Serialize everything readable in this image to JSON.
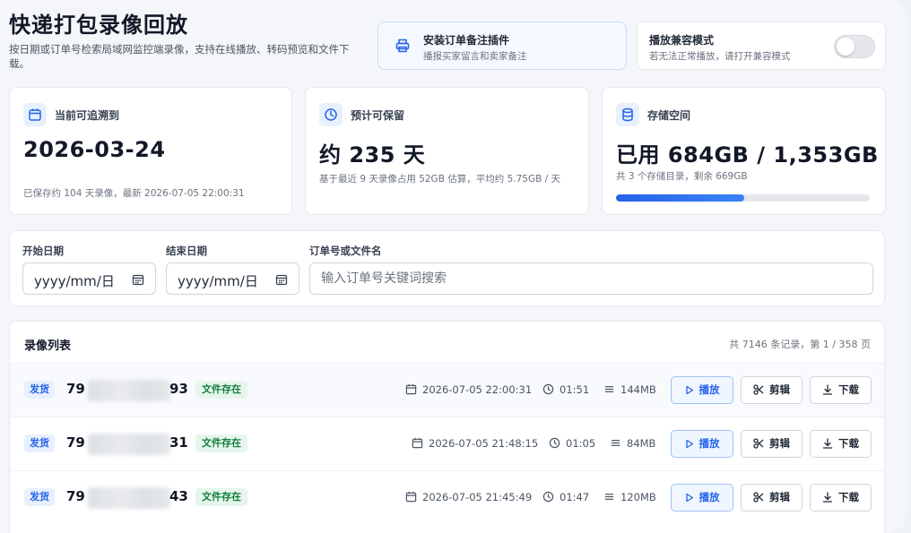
{
  "header": {
    "title": "快递打包录像回放",
    "description": "按日期或订单号检索局域网监控端录像，支持在线播放、转码预览和文件下载。"
  },
  "plugin": {
    "title": "安装订单备注插件",
    "subtitle": "播报买家留言和卖家备注",
    "icon": "printer-icon"
  },
  "compat": {
    "title": "播放兼容模式",
    "subtitle": "若无法正常播放，请打开兼容模式",
    "enabled": false
  },
  "stats": {
    "earliest": {
      "label": "当前可追溯到",
      "value": "2026-03-24",
      "note": "已保存约 104 天录像，最新 2026-07-05 22:00:31",
      "icon": "calendar-icon"
    },
    "retention": {
      "label": "预计可保留",
      "value": "约 235 天",
      "note": "基于最近 9 天录像占用 52GB 估算，平均约 5.75GB / 天",
      "icon": "clock-icon"
    },
    "storage": {
      "label": "存储空间",
      "value": "已用 684GB / 1,353GB",
      "note": "共 3 个存储目录，剩余 669GB",
      "icon": "database-icon",
      "used_fraction": 0.5055
    }
  },
  "filters": {
    "start_label": "开始日期",
    "start_value": "yyyy/mm/日",
    "end_label": "结束日期",
    "end_value": "yyyy/mm/日",
    "search_label": "订单号或文件名",
    "search_placeholder": "输入订单号关键词搜索"
  },
  "list": {
    "title": "录像列表",
    "count": "共 7146 条记录，第 1 / 358 页",
    "play_label": "播放",
    "cut_label": "剪辑",
    "download_label": "下载",
    "rows": [
      {
        "type": "发货",
        "order_prefix": "79",
        "order_suffix": "93",
        "status": "文件存在",
        "datetime": "2026-07-05 22:00:31",
        "duration": "01:51",
        "size": "144MB"
      },
      {
        "type": "发货",
        "order_prefix": "79",
        "order_suffix": "31",
        "status": "文件存在",
        "datetime": "2026-07-05 21:48:15",
        "duration": "01:05",
        "size": "84MB"
      },
      {
        "type": "发货",
        "order_prefix": "79",
        "order_suffix": "43",
        "status": "文件存在",
        "datetime": "2026-07-05 21:45:49",
        "duration": "01:47",
        "size": "120MB"
      }
    ]
  },
  "colors": {
    "accent": "#2563eb",
    "success": "#15803d",
    "background": "#f4f6f9"
  }
}
